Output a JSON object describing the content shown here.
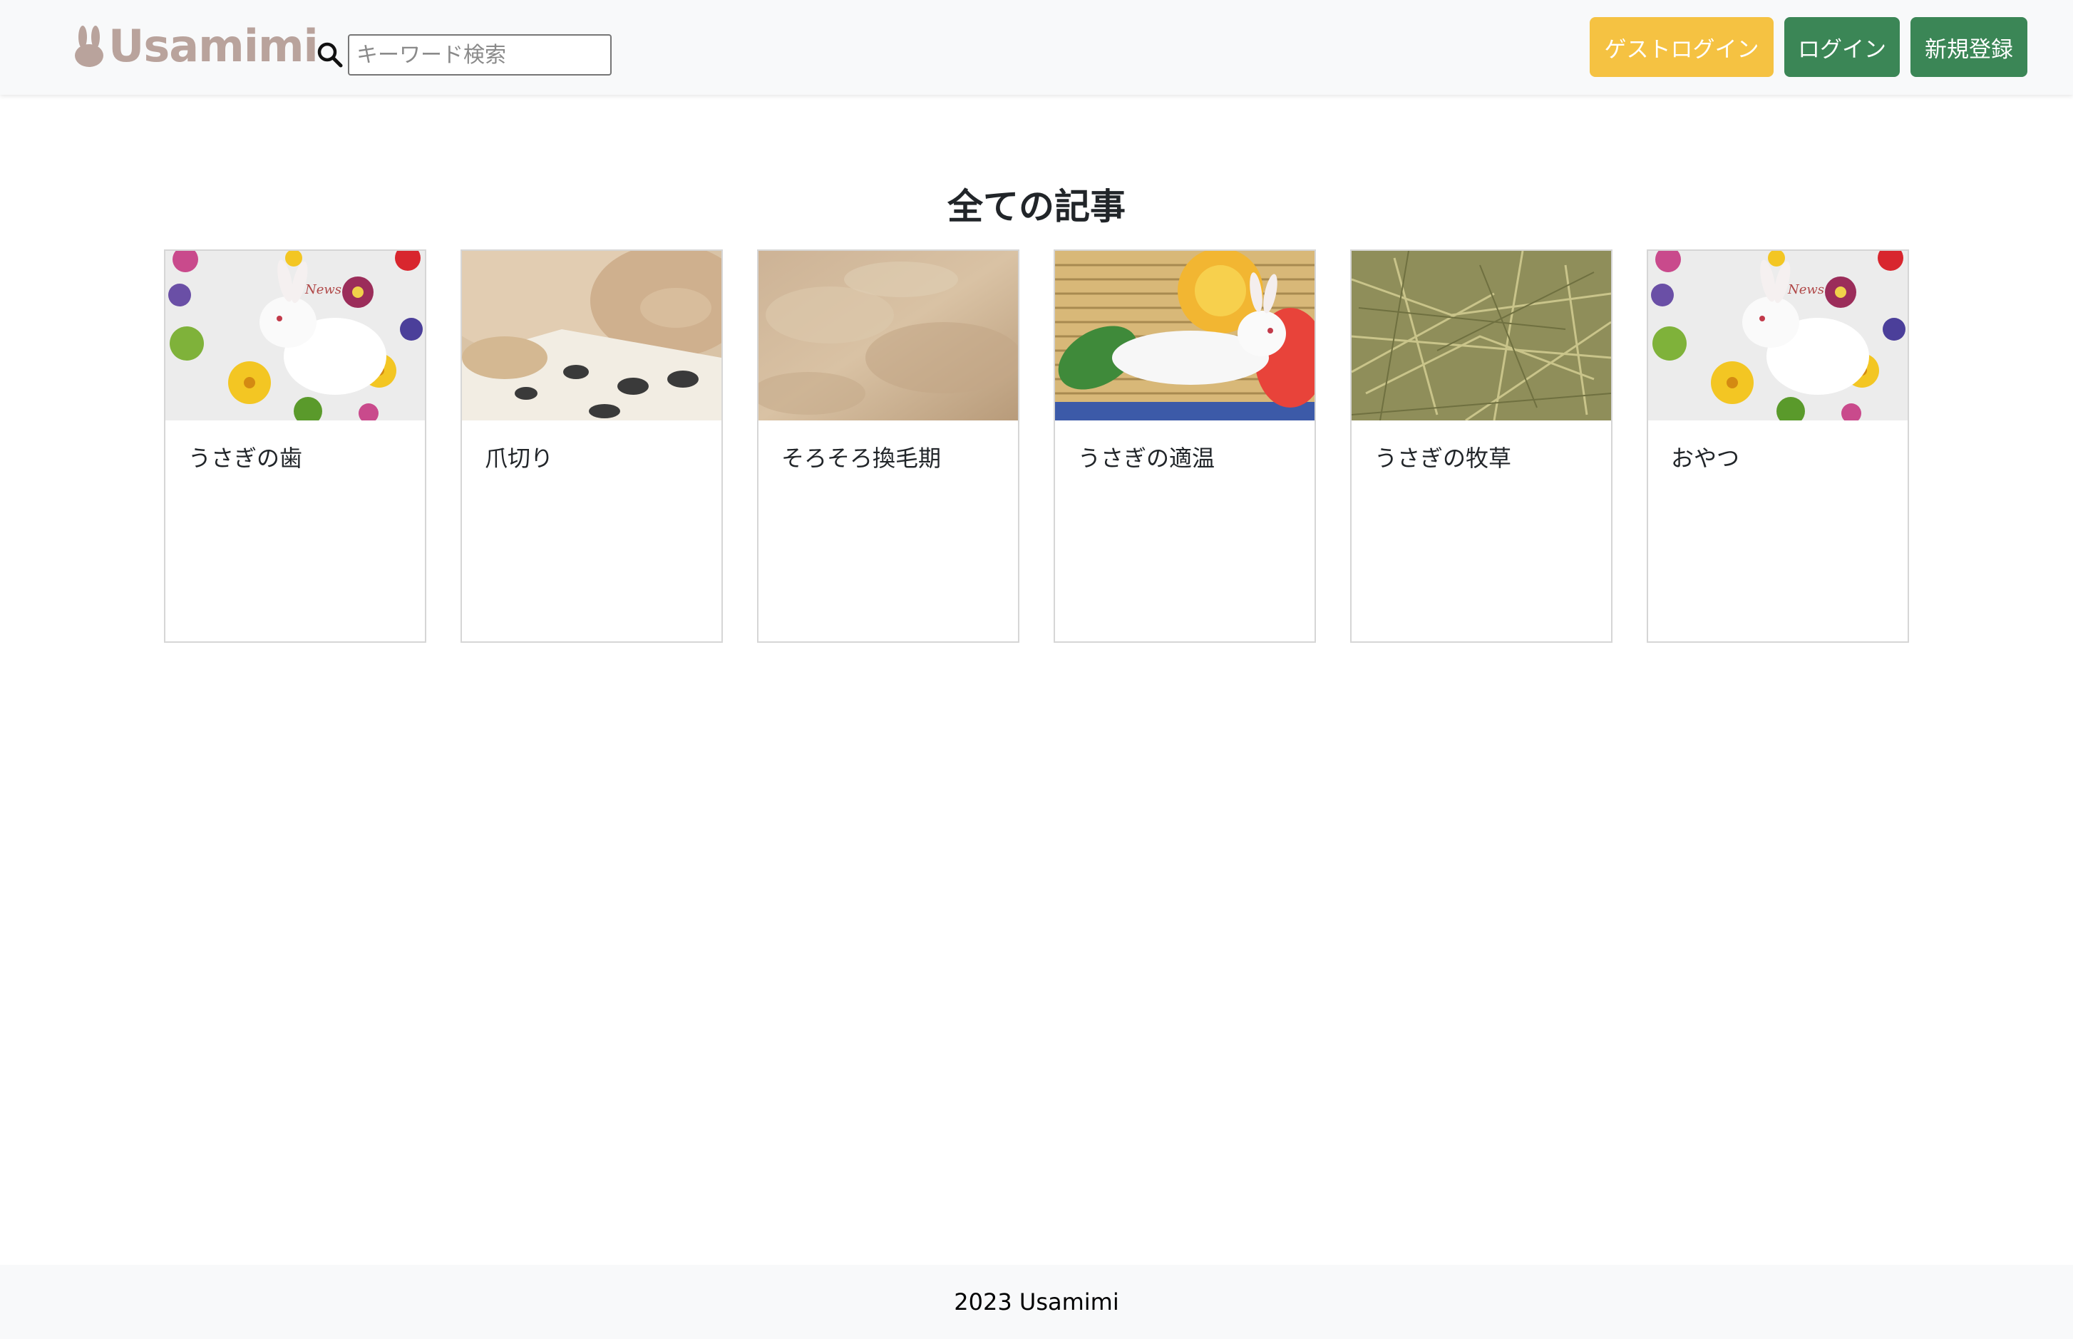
{
  "header": {
    "logo_text": "Usamimi",
    "search": {
      "placeholder": "キーワード検索",
      "value": ""
    },
    "buttons": {
      "guest_login": "ゲストログイン",
      "login": "ログイン",
      "signup": "新規登録"
    }
  },
  "main": {
    "title": "全ての記事",
    "articles": [
      {
        "title": "うさぎの歯",
        "image": "white-rabbit-with-flowers"
      },
      {
        "title": "爪切り",
        "image": "rabbit-paws-on-mat"
      },
      {
        "title": "そろそろ換毛期",
        "image": "rabbit-fur-closeup"
      },
      {
        "title": "うさぎの適温",
        "image": "white-rabbit-on-bamboo-mat"
      },
      {
        "title": "うさぎの牧草",
        "image": "hay-closeup"
      },
      {
        "title": "おやつ",
        "image": "white-rabbit-with-flowers"
      }
    ]
  },
  "footer": {
    "text": "2023 Usamimi"
  },
  "colors": {
    "navbar_bg": "#f8f9fa",
    "guest_button": "#f5c242",
    "green_button": "#3b8656",
    "logo": "#b9a39c"
  }
}
